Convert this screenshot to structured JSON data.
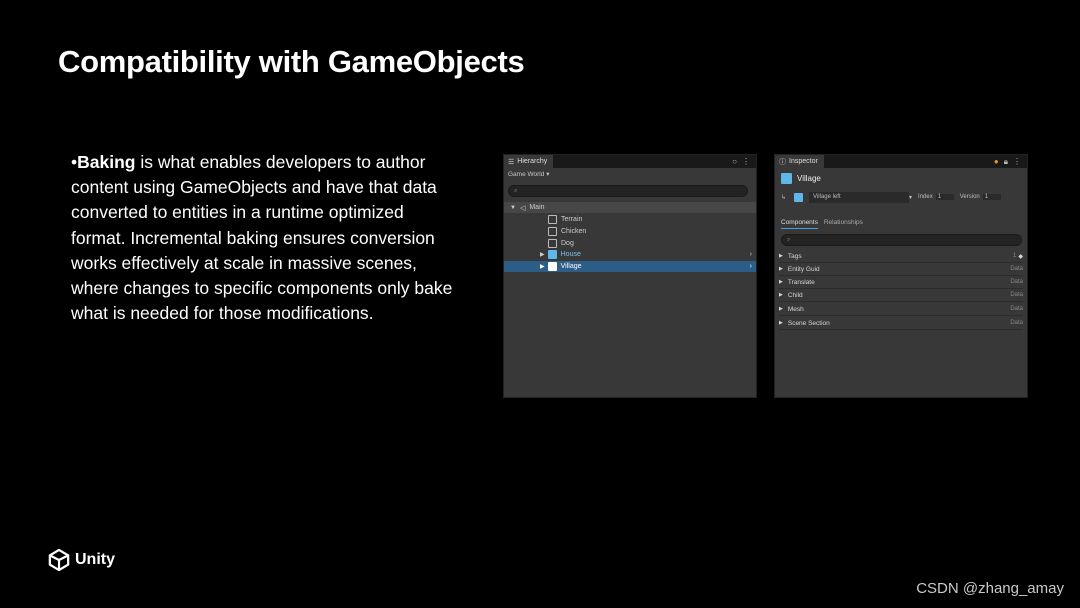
{
  "slide": {
    "title": "Compatibility with GameObjects",
    "bullet_prefix": "•",
    "bullet_bold": "Baking",
    "bullet_text": " is what enables developers to author content using GameObjects and have that data converted to entities in a runtime optimized format. Incremental baking ensures conversion works effectively at scale in massive scenes, where changes to specific components only bake what is needed for those modifications."
  },
  "hierarchy": {
    "tab_label": "Hierarchy",
    "world_label": "Game World",
    "root": "Main",
    "children": [
      "Terrain",
      "Chicken",
      "Dog",
      "House",
      "Village"
    ]
  },
  "inspector": {
    "tab_label": "Inspector",
    "entity_name": "Village",
    "entity_ref": "Village left",
    "index_label": "Index",
    "index_value": "1",
    "version_label": "Version",
    "version_value": "1",
    "tabs": [
      "Components",
      "Relationships"
    ],
    "components": [
      {
        "name": "Tags",
        "value": "1"
      },
      {
        "name": "Entity Guid",
        "value": "Data"
      },
      {
        "name": "Translate",
        "value": "Data"
      },
      {
        "name": "Child",
        "value": "Data"
      },
      {
        "name": "Mesh",
        "value": "Data"
      },
      {
        "name": "Scene Section",
        "value": "Data"
      }
    ]
  },
  "footer": {
    "logo_text": "Unity",
    "watermark": "CSDN @zhang_amay"
  },
  "colors": {
    "selection": "#2c5d87",
    "entity_icon": "#5fb6e8",
    "accent": "#e8912a"
  }
}
